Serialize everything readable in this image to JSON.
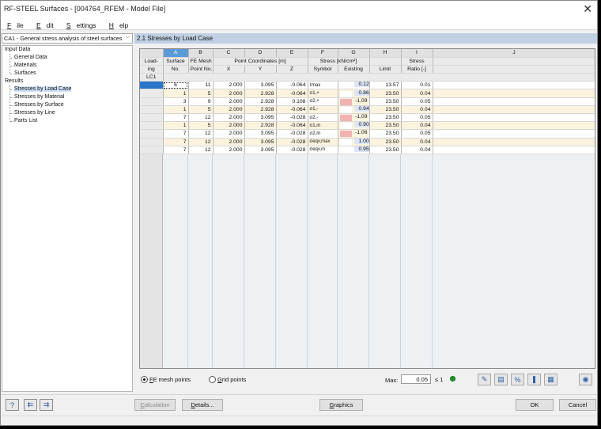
{
  "window": {
    "title": "RF-STEEL Surfaces - [004764_RFEM - Model File]",
    "close_glyph": "✕"
  },
  "menu": [
    {
      "ul": "F",
      "rest": "ile"
    },
    {
      "ul": "E",
      "rest": "dit"
    },
    {
      "ul": "S",
      "rest": "ettings"
    },
    {
      "ul": "H",
      "rest": "elp"
    }
  ],
  "case_combo": {
    "value": "CA1 - General stress analysis of steel surfaces",
    "arrow": "⌵"
  },
  "tree": {
    "input_data": "Input Data",
    "general_data": "General Data",
    "materials": "Materials",
    "surfaces": "Surfaces",
    "results": "Results",
    "by_load_case": "Stresses by Load Case",
    "by_material": "Stresses by Material",
    "by_surface": "Stresses by Surface",
    "by_line": "Stresses by Line",
    "parts_list": "Parts List"
  },
  "panel_title": "2.1 Stresses by Load Case",
  "table": {
    "letters": [
      "A",
      "B",
      "C",
      "D",
      "E",
      "F",
      "G",
      "H",
      "I",
      "J"
    ],
    "header1": {
      "loading": "Load-",
      "surface": "Surface",
      "fe_mesh": "FE Mesh",
      "point_coords": "Point Coordinates [m]",
      "stress": "Stress [kN/cm²]",
      "stress_ratio": "Stress"
    },
    "header2": {
      "loading": "ing",
      "surface_no": "No.",
      "point_no": "Point No.",
      "x": "X",
      "y": "Y",
      "z": "Z",
      "symbol": "Symbol",
      "existing": "Existing",
      "limit": "Limit",
      "ratio": "Ratio [-]"
    },
    "load_case": "LC1",
    "rows": [
      {
        "surface": "6",
        "point": "11",
        "x": "2.000",
        "y": "3.095",
        "z": "-0.064",
        "symbol": "τmax",
        "existing": "0.12",
        "limit": "13.57",
        "ratio": "0.01",
        "neg": false
      },
      {
        "surface": "1",
        "point": "5",
        "x": "2.000",
        "y": "2.928",
        "z": "-0.064",
        "symbol": "σ1,+",
        "existing": "0.86",
        "limit": "23.50",
        "ratio": "0.04",
        "neg": false
      },
      {
        "surface": "3",
        "point": "9",
        "x": "2.000",
        "y": "2.928",
        "z": "0.108",
        "symbol": "σ2,+",
        "existing": "-1.09",
        "limit": "23.50",
        "ratio": "0.05",
        "neg": true
      },
      {
        "surface": "1",
        "point": "5",
        "x": "2.000",
        "y": "2.928",
        "z": "-0.064",
        "symbol": "σ1,-",
        "existing": "0.94",
        "limit": "23.50",
        "ratio": "0.04",
        "neg": false
      },
      {
        "surface": "7",
        "point": "12",
        "x": "2.000",
        "y": "3.095",
        "z": "-0.028",
        "symbol": "σ2,-",
        "existing": "-1.09",
        "limit": "23.50",
        "ratio": "0.05",
        "neg": true
      },
      {
        "surface": "1",
        "point": "5",
        "x": "2.000",
        "y": "2.928",
        "z": "-0.064",
        "symbol": "σ1,m",
        "existing": "0.90",
        "limit": "23.50",
        "ratio": "0.04",
        "neg": false
      },
      {
        "surface": "7",
        "point": "12",
        "x": "2.000",
        "y": "3.095",
        "z": "-0.028",
        "symbol": "σ2,m",
        "existing": "-1.06",
        "limit": "23.50",
        "ratio": "0.05",
        "neg": true
      },
      {
        "surface": "7",
        "point": "12",
        "x": "2.000",
        "y": "3.095",
        "z": "-0.028",
        "symbol": "σeqv,max",
        "existing": "1.00",
        "limit": "23.50",
        "ratio": "0.04",
        "neg": false
      },
      {
        "surface": "7",
        "point": "12",
        "x": "2.000",
        "y": "3.095",
        "z": "-0.028",
        "symbol": "σeqv,m",
        "existing": "0.95",
        "limit": "23.50",
        "ratio": "0.04",
        "neg": false
      }
    ]
  },
  "options": {
    "fe_mesh_points": "FE mesh points",
    "fe_mesh_ul": "F",
    "grid_points": "Grid points",
    "grid_ul": "G",
    "max_label": "Max:",
    "max_value": "0.05",
    "le_one": "≤ 1"
  },
  "toolbar_icons": [
    "export-excel-icon",
    "filter-icon",
    "relative-values-icon",
    "color-scale-icon",
    "excel-icon",
    "view-icon"
  ],
  "buttons": {
    "calculation": "Calculation",
    "calculation_ul": "C",
    "details": "Details...",
    "details_ul": "D",
    "graphics": "Graphics",
    "graphics_ul": "G",
    "ok": "OK",
    "cancel": "Cancel"
  },
  "colors": {
    "header_bar": "#bfd0e3",
    "column_a_selected": "#5b9bd5",
    "row_highlight": "#fbf3de",
    "negative_bar": "#f1b2b2",
    "ok_status": "#1a9a2a"
  }
}
